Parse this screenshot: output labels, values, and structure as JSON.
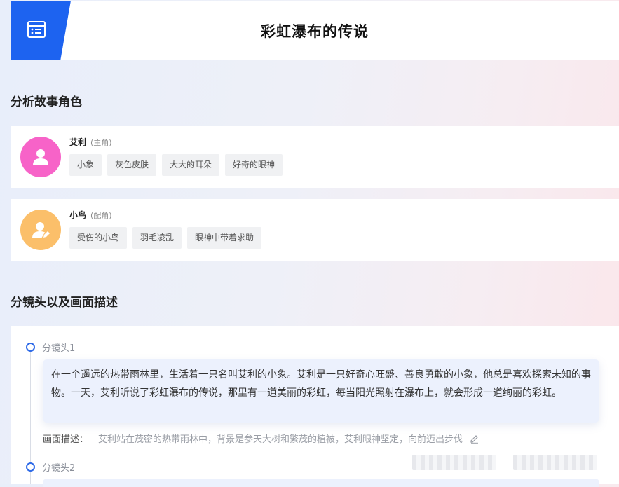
{
  "header": {
    "title": "彩虹瀑布的传说",
    "icon": "document-list-icon"
  },
  "characters_section": {
    "title": "分析故事角色"
  },
  "characters": [
    {
      "name": "艾利",
      "role": "(主角)",
      "avatar_color": "#f763c8",
      "avatar_icon": "user-icon",
      "tags": [
        "小象",
        "灰色皮肤",
        "大大的耳朵",
        "好奇的眼神"
      ]
    },
    {
      "name": "小鸟",
      "role": "(配角)",
      "avatar_color": "#fbbf6a",
      "avatar_icon": "user-edit-icon",
      "tags": [
        "受伤的小鸟",
        "羽毛凌乱",
        "眼神中带着求助"
      ]
    }
  ],
  "shots_section": {
    "title": "分镜头以及画面描述"
  },
  "shots": [
    {
      "label": "分镜头1",
      "text": "在一个遥远的热带雨林里，生活着一只名叫艾利的小象。艾利是一只好奇心旺盛、善良勇敢的小象，他总是喜欢探索未知的事物。一天，艾利听说了彩虹瀑布的传说，那里有一道美丽的彩虹，每当阳光照射在瀑布上，就会形成一道绚丽的彩虹。",
      "desc_label": "画面描述：",
      "desc_value": "艾利站在茂密的热带雨林中，背景是参天大树和繁茂的植被，艾利眼神坚定，向前迈出步伐"
    },
    {
      "label": "分镜头2"
    }
  ],
  "colors": {
    "accent": "#1d63f0",
    "timeline_dot": "#2f6be8"
  }
}
